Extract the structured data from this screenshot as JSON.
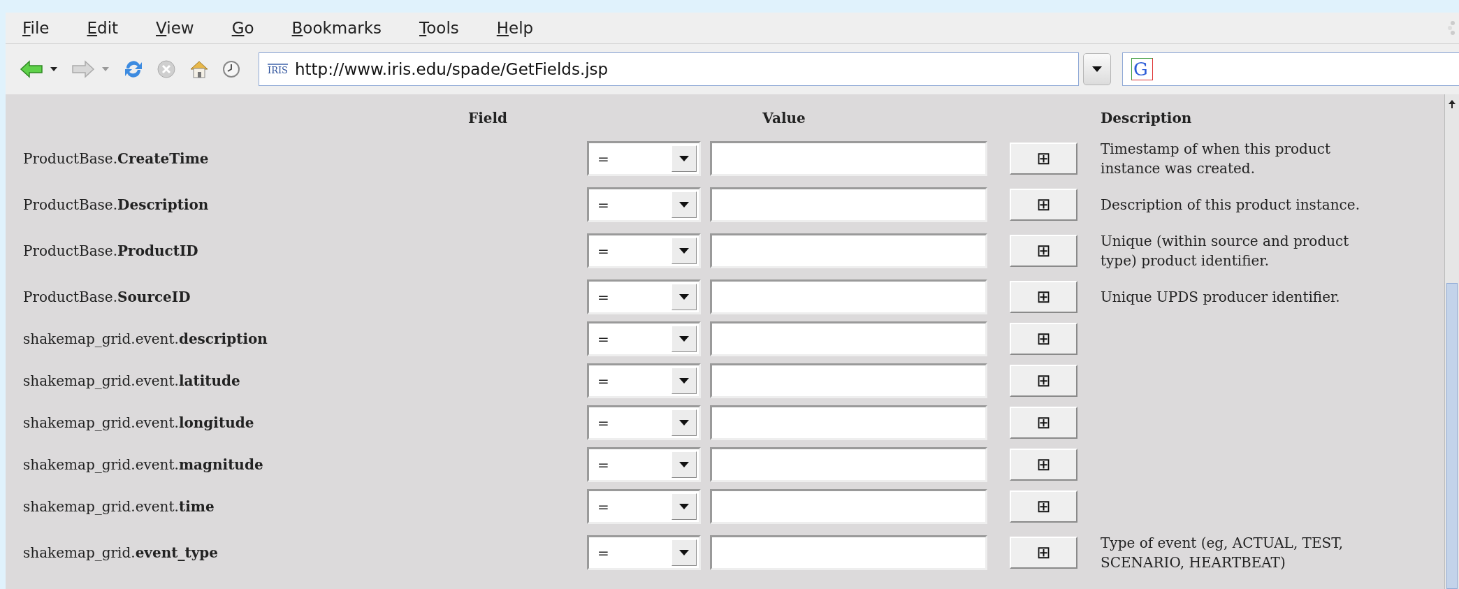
{
  "menu": [
    {
      "label": "File"
    },
    {
      "label": "Edit"
    },
    {
      "label": "View"
    },
    {
      "label": "Go"
    },
    {
      "label": "Bookmarks"
    },
    {
      "label": "Tools"
    },
    {
      "label": "Help"
    }
  ],
  "toolbar": {
    "site_logo": "IRIS",
    "url": "http://www.iris.edu/spade/GetFields.jsp",
    "search_engine": "G"
  },
  "table": {
    "columns": [
      "Field",
      "Value",
      "Description"
    ],
    "rows": [
      {
        "field": "ProductBase.**CreateTime**",
        "operator": "=",
        "add_button": "⊞",
        "description": [
          "Timestamp of when this product",
          "instance was created."
        ]
      },
      {
        "field": "ProductBase.**Description**",
        "operator": "=",
        "add_button": "⊞",
        "description": [
          "Description of this product instance."
        ]
      },
      {
        "field": "ProductBase.**ProductID**",
        "operator": "=",
        "add_button": "⊞",
        "description": [
          "Unique (within source and product",
          "type) product identifier."
        ]
      },
      {
        "field": "ProductBase.**SourceID**",
        "operator": "=",
        "add_button": "⊞",
        "description": [
          "Unique UPDS producer identifier."
        ]
      },
      {
        "field": "shakemap_grid.event.**description**",
        "operator": "=",
        "add_button": "⊞"
      },
      {
        "field": "shakemap_grid.event.**latitude**",
        "operator": "=",
        "add_button": "⊞"
      },
      {
        "field": "shakemap_grid.event.**longitude**",
        "operator": "=",
        "add_button": "⊞"
      },
      {
        "field": "shakemap_grid.event.**magnitude**",
        "operator": "=",
        "add_button": "⊞"
      },
      {
        "field": "shakemap_grid.event.**time**",
        "operator": "=",
        "add_button": "⊞"
      },
      {
        "field": "shakemap_grid.**event_type**",
        "operator": "=",
        "add_button": "⊞",
        "description": [
          "Type of event (eg, ACTUAL, TEST,",
          "SCENARIO, HEARTBEAT)"
        ]
      }
    ]
  }
}
